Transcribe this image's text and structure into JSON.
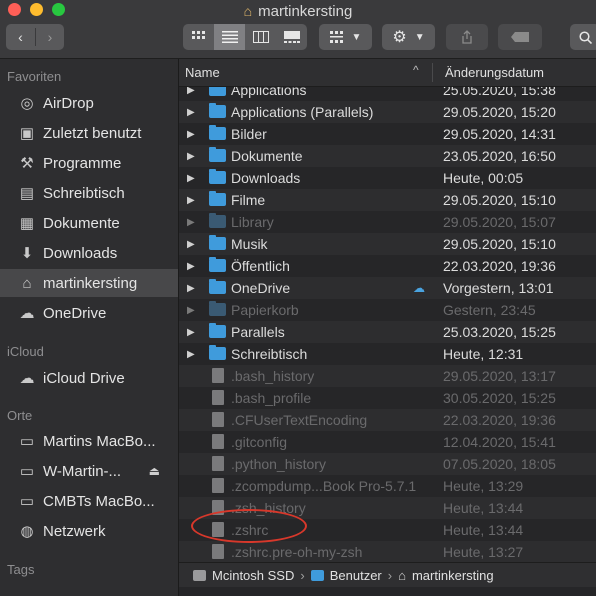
{
  "window": {
    "title": "martinkersting"
  },
  "toolbar": {
    "back_icon": "chevron-left-icon",
    "forward_icon": "chevron-right-icon",
    "views": [
      "icon-view",
      "list-view",
      "column-view",
      "gallery-view"
    ],
    "active_view": "list-view"
  },
  "sidebar": {
    "favorites_header": "Favoriten",
    "favorites": [
      {
        "label": "AirDrop",
        "icon": "airdrop-icon"
      },
      {
        "label": "Zuletzt benutzt",
        "icon": "recents-icon"
      },
      {
        "label": "Programme",
        "icon": "applications-icon"
      },
      {
        "label": "Schreibtisch",
        "icon": "desktop-icon"
      },
      {
        "label": "Dokumente",
        "icon": "documents-icon"
      },
      {
        "label": "Downloads",
        "icon": "downloads-icon"
      },
      {
        "label": "martinkersting",
        "icon": "home-icon",
        "selected": true
      },
      {
        "label": "OneDrive",
        "icon": "cloud-icon"
      }
    ],
    "icloud_header": "iCloud",
    "icloud": [
      {
        "label": "iCloud Drive",
        "icon": "cloud-icon"
      }
    ],
    "locations_header": "Orte",
    "locations": [
      {
        "label": "Martins MacBo...",
        "icon": "laptop-icon"
      },
      {
        "label": "W-Martin-...",
        "icon": "display-icon"
      },
      {
        "label": "CMBTs MacBo...",
        "icon": "laptop-icon"
      },
      {
        "label": "Netzwerk",
        "icon": "network-icon"
      }
    ],
    "tags_header": "Tags"
  },
  "columns": {
    "name": "Name",
    "date": "Änderungsdatum"
  },
  "files": [
    {
      "name": "Applications",
      "date": "25.05.2020, 15:38",
      "type": "folder",
      "dim": false
    },
    {
      "name": "Applications (Parallels)",
      "date": "29.05.2020, 15:20",
      "type": "folder",
      "dim": false
    },
    {
      "name": "Bilder",
      "date": "29.05.2020, 14:31",
      "type": "folder",
      "dim": false
    },
    {
      "name": "Dokumente",
      "date": "23.05.2020, 16:50",
      "type": "folder",
      "dim": false
    },
    {
      "name": "Downloads",
      "date": "Heute, 00:05",
      "type": "folder",
      "dim": false
    },
    {
      "name": "Filme",
      "date": "29.05.2020, 15:10",
      "type": "folder",
      "dim": false
    },
    {
      "name": "Library",
      "date": "29.05.2020, 15:07",
      "type": "folder",
      "dim": true
    },
    {
      "name": "Musik",
      "date": "29.05.2020, 15:10",
      "type": "folder",
      "dim": false
    },
    {
      "name": "Öffentlich",
      "date": "22.03.2020, 19:36",
      "type": "folder",
      "dim": false
    },
    {
      "name": "OneDrive",
      "date": "Vorgestern, 13:01",
      "type": "folder",
      "dim": false,
      "cloud": true
    },
    {
      "name": "Papierkorb",
      "date": "Gestern, 23:45",
      "type": "folder",
      "dim": true
    },
    {
      "name": "Parallels",
      "date": "25.03.2020, 15:25",
      "type": "folder",
      "dim": false
    },
    {
      "name": "Schreibtisch",
      "date": "Heute, 12:31",
      "type": "folder",
      "dim": false
    },
    {
      "name": ".bash_history",
      "date": "29.05.2020, 13:17",
      "type": "file",
      "dim": true
    },
    {
      "name": ".bash_profile",
      "date": "30.05.2020, 15:25",
      "type": "file",
      "dim": true
    },
    {
      "name": ".CFUserTextEncoding",
      "date": "22.03.2020, 19:36",
      "type": "file",
      "dim": true
    },
    {
      "name": ".gitconfig",
      "date": "12.04.2020, 15:41",
      "type": "file",
      "dim": true
    },
    {
      "name": ".python_history",
      "date": "07.05.2020, 18:05",
      "type": "file",
      "dim": true
    },
    {
      "name": ".zcompdump...Book Pro-5.7.1",
      "date": "Heute, 13:29",
      "type": "file",
      "dim": true
    },
    {
      "name": ".zsh_history",
      "date": "Heute, 13:44",
      "type": "file",
      "dim": true
    },
    {
      "name": ".zshrc",
      "date": "Heute, 13:44",
      "type": "file",
      "dim": true,
      "highlighted": true
    },
    {
      "name": ".zshrc.pre-oh-my-zsh",
      "date": "Heute, 13:27",
      "type": "file",
      "dim": true
    }
  ],
  "pathbar": [
    {
      "label": "Mcintosh SSD",
      "icon": "disk-icon"
    },
    {
      "label": "Benutzer",
      "icon": "folder-icon"
    },
    {
      "label": "martinkersting",
      "icon": "home-icon"
    }
  ],
  "colors": {
    "folder": "#3f9bdc",
    "highlight_circle": "#d8382b",
    "selection": "#48484a"
  }
}
